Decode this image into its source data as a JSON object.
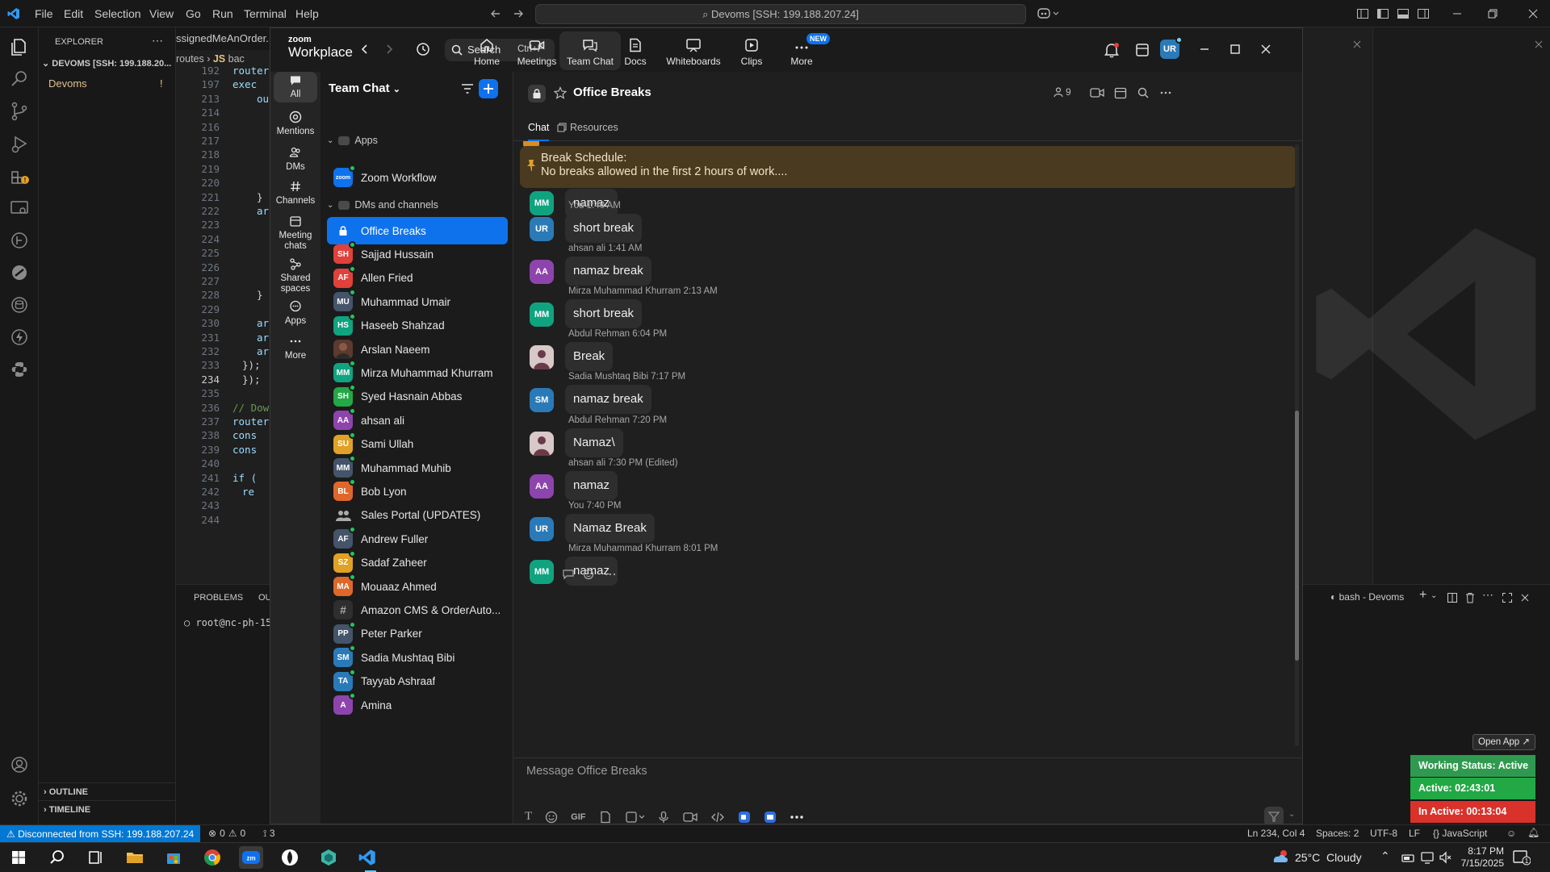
{
  "vscode": {
    "menu": [
      "File",
      "Edit",
      "Selection",
      "View",
      "Go",
      "Run",
      "Terminal",
      "Help"
    ],
    "command_center": "Devoms [SSH: 199.188.207.24]",
    "explorer": {
      "title": "EXPLORER",
      "root": "DEVOMS [SSH: 199.188.20...",
      "item": "Devoms",
      "item_badge": "!",
      "outline": "OUTLINE",
      "timeline": "TIMELINE"
    },
    "editor": {
      "tab_fragment": "ssignedMeAnOrder...",
      "breadcrumb_routes": "routes",
      "breadcrumb_js": "JS",
      "breadcrumb_file": "bac",
      "line_numbers": [
        "192",
        "197",
        "213",
        "214",
        "216",
        "217",
        "218",
        "219",
        "220",
        "221",
        "222",
        "223",
        "224",
        "225",
        "226",
        "227",
        "228",
        "229",
        "230",
        "231",
        "232",
        "233",
        "234",
        "235",
        "236",
        "237",
        "238",
        "239",
        "240",
        "241",
        "242",
        "243",
        "244"
      ],
      "code_lines": [
        "router",
        "exec",
        "ou",
        "",
        "",
        "",
        "",
        "",
        "",
        "}",
        "ar",
        "",
        "",
        "",
        "",
        "",
        "}",
        "",
        "ar",
        "ar",
        "ar",
        "});",
        "});",
        "",
        "// Dow",
        "router",
        "cons",
        "cons",
        "",
        "if (",
        "re",
        "",
        ""
      ]
    },
    "panel": {
      "tab_problems": "PROBLEMS",
      "tab_output": "OU",
      "terminal_line": "root@nc-ph-15"
    },
    "terminal": {
      "title": "bash - Devoms"
    },
    "statusbar": {
      "remote": "Disconnected from SSH: 199.188.207.24",
      "errors": "0",
      "warnings": "0",
      "ports": "3",
      "cursor": "Ln 234, Col 4",
      "spaces": "Spaces: 2",
      "encoding": "UTF-8",
      "eol": "LF",
      "language": "JavaScript"
    }
  },
  "zoom": {
    "brand_top": "zoom",
    "brand_bottom": "Workplace",
    "search_label": "Search",
    "search_shortcut": "Ctrl+F",
    "nav": [
      {
        "label": "Home",
        "icon": "home-icon"
      },
      {
        "label": "Meetings",
        "icon": "video-icon"
      },
      {
        "label": "Team Chat",
        "icon": "chat-icon"
      },
      {
        "label": "Docs",
        "icon": "doc-icon"
      },
      {
        "label": "Whiteboards",
        "icon": "whiteboard-icon"
      },
      {
        "label": "Clips",
        "icon": "clips-icon"
      },
      {
        "label": "More",
        "icon": "more-icon"
      }
    ],
    "new_badge": "NEW",
    "user_initials": "UR",
    "rail": [
      {
        "label": "All"
      },
      {
        "label": "Mentions"
      },
      {
        "label": "DMs"
      },
      {
        "label": "Channels"
      },
      {
        "label": "Meeting chats"
      },
      {
        "label": "Shared spaces"
      },
      {
        "label": "Apps"
      },
      {
        "label": "More"
      }
    ],
    "sidebar": {
      "title": "Team Chat",
      "section_apps": "Apps",
      "apps": [
        {
          "name": "Zoom Workflow",
          "initials": "zoom",
          "color": "#0e72ed"
        }
      ],
      "section_dms": "DMs and channels",
      "items": [
        {
          "name": "Office Breaks",
          "initials": "",
          "color": "#0e72ed",
          "type": "lock"
        },
        {
          "name": "Sajjad Hussain",
          "initials": "SH",
          "color": "#e0413a",
          "type": "dm"
        },
        {
          "name": "Allen Fried",
          "initials": "AF",
          "color": "#e0413a",
          "type": "dm"
        },
        {
          "name": "Muhammad Umair",
          "initials": "MU",
          "color": "#44546a",
          "type": "dm"
        },
        {
          "name": "Haseeb Shahzad",
          "initials": "HS",
          "color": "#10a37f",
          "type": "dm"
        },
        {
          "name": "Arslan Naeem",
          "initials": "",
          "color": "#5c3a2e",
          "type": "photo"
        },
        {
          "name": "Mirza Muhammad Khurram",
          "initials": "MM",
          "color": "#10a37f",
          "type": "dm"
        },
        {
          "name": "Syed Hasnain Abbas",
          "initials": "SH",
          "color": "#22a845",
          "type": "dm"
        },
        {
          "name": "ahsan ali",
          "initials": "AA",
          "color": "#8e44ad",
          "type": "dm"
        },
        {
          "name": "Sami Ullah",
          "initials": "SU",
          "color": "#e0a126",
          "type": "dm"
        },
        {
          "name": "Muhammad Muhib",
          "initials": "MM",
          "color": "#44546a",
          "type": "dm"
        },
        {
          "name": "Bob Lyon",
          "initials": "BL",
          "color": "#e0672a",
          "type": "dm"
        },
        {
          "name": "Sales Portal (UPDATES)",
          "initials": "",
          "color": "#3a3a3a",
          "type": "group"
        },
        {
          "name": "Andrew Fuller",
          "initials": "AF",
          "color": "#44546a",
          "type": "dm"
        },
        {
          "name": "Sadaf Zaheer",
          "initials": "SZ",
          "color": "#e0a126",
          "type": "dm"
        },
        {
          "name": "Mouaaz Ahmed",
          "initials": "MA",
          "color": "#e0672a",
          "type": "dm"
        },
        {
          "name": "Amazon CMS & OrderAuto...",
          "initials": "#",
          "color": "#2e2e2e",
          "type": "channel"
        },
        {
          "name": "Peter Parker",
          "initials": "PP",
          "color": "#44546a",
          "type": "dm"
        },
        {
          "name": "Sadia Mushtaq Bibi",
          "initials": "SM",
          "color": "#2a7ab8",
          "type": "dm"
        },
        {
          "name": "Tayyab Ashraaf",
          "initials": "TA",
          "color": "#2a7ab8",
          "type": "dm"
        },
        {
          "name": "Amina",
          "initials": "A",
          "color": "#8e44ad",
          "type": "dm"
        }
      ]
    },
    "chat": {
      "title": "Office Breaks",
      "members": "9",
      "tab_chat": "Chat",
      "tab_resources": "Resources",
      "pinned_title": "Break Schedule:",
      "pinned_text": "No breaks allowed in the first 2 hours of work....",
      "messages": [
        {
          "initials": "MM",
          "color": "#10a37f",
          "meta": "",
          "text": "namaz"
        },
        {
          "initials": "UR",
          "color": "#2a7ab8",
          "meta": "You 1:40 AM",
          "text": "short break"
        },
        {
          "initials": "AA",
          "color": "#8e44ad",
          "meta": "ahsan ali 1:41 AM",
          "text": "namaz break"
        },
        {
          "initials": "MM",
          "color": "#10a37f",
          "meta": "Mirza Muhammad Khurram 2:13 AM",
          "text": "short break"
        },
        {
          "initials": "",
          "color": "#6b3a4a",
          "meta": "Abdul Rehman 6:04 PM",
          "text": "Break"
        },
        {
          "initials": "SM",
          "color": "#2a7ab8",
          "meta": "Sadia Mushtaq Bibi 7:17 PM",
          "text": "namaz break"
        },
        {
          "initials": "",
          "color": "#6b3a4a",
          "meta": "Abdul Rehman 7:20 PM",
          "text": "Namaz\\"
        },
        {
          "initials": "AA",
          "color": "#8e44ad",
          "meta": "ahsan ali 7:30 PM (Edited)",
          "text": "namaz"
        },
        {
          "initials": "UR",
          "color": "#2a7ab8",
          "meta": "You 7:40 PM",
          "text": "Namaz Break"
        },
        {
          "initials": "MM",
          "color": "#10a37f",
          "meta": "Mirza Muhammad Khurram 8:01 PM",
          "text": "namaz"
        }
      ],
      "composer_placeholder": "Message Office Breaks",
      "gif_label": "GIF"
    }
  },
  "work_status": {
    "open_app": "Open App ↗",
    "status": "Working Status: Active",
    "active": "Active: 02:43:01",
    "inactive": "In Active: 00:13:04",
    "colors": {
      "status": "#2f9a4f",
      "active": "#22a845",
      "inactive": "#d9322b"
    }
  },
  "taskbar": {
    "weather": "25°C  Cloudy",
    "time": "8:17 PM",
    "date": "7/15/2025",
    "notification_count": "1"
  },
  "colors": {
    "zoom_blue": "#0e72ed",
    "vscode_blue": "#0078d4",
    "pinned_bg": "#4a3a1f"
  }
}
